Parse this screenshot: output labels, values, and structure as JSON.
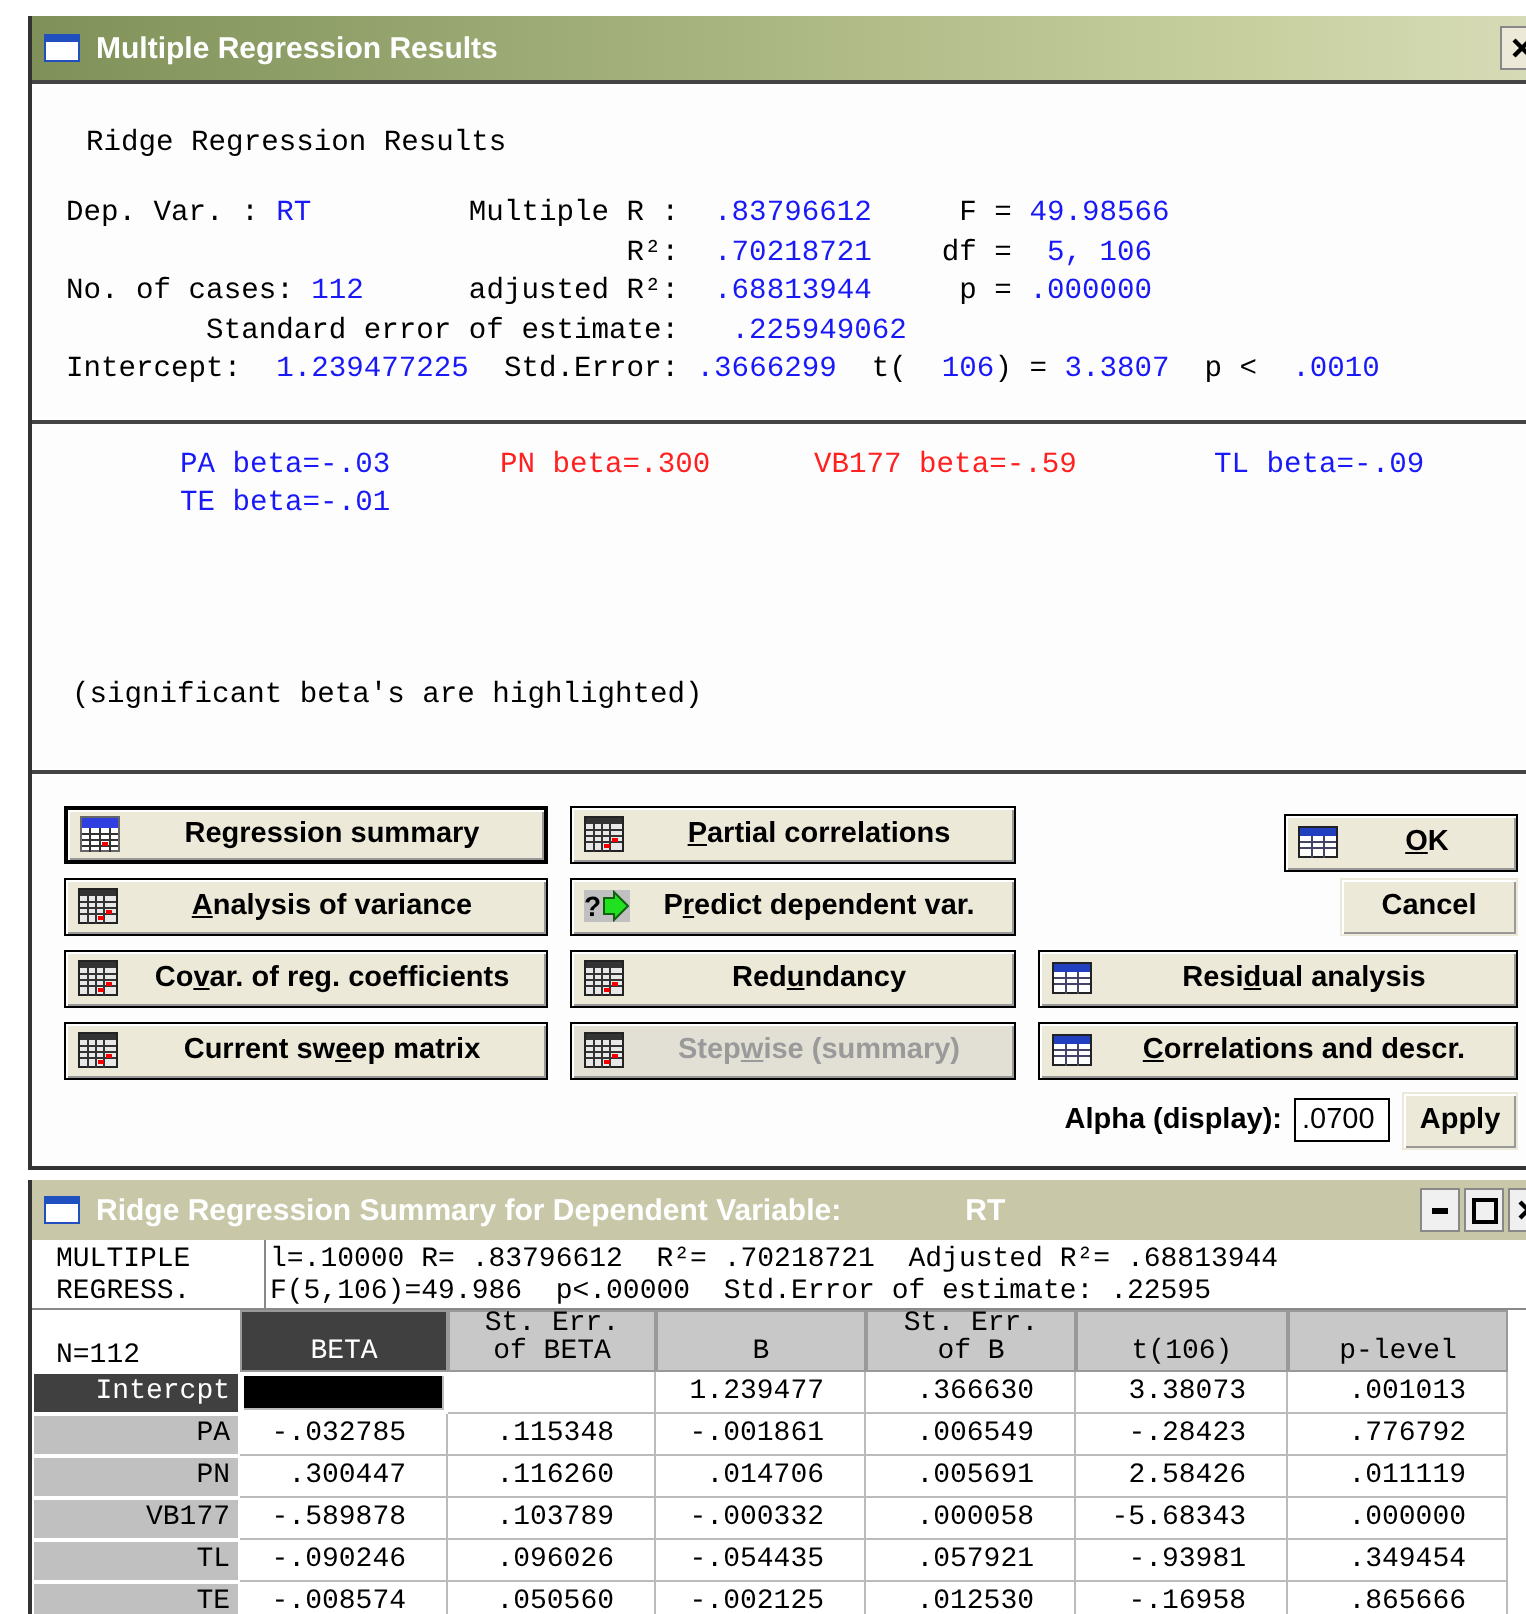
{
  "window": {
    "title": "Multiple Regression Results"
  },
  "results": {
    "heading": "Ridge Regression Results",
    "lines": [
      [
        {
          "kind": "label",
          "text": "Dep. Var. : "
        },
        {
          "kind": "value",
          "text": "RT"
        },
        {
          "kind": "label",
          "text": "         Multiple R :  "
        },
        {
          "kind": "value",
          "text": ".83796612"
        },
        {
          "kind": "label",
          "text": "     F = "
        },
        {
          "kind": "value",
          "text": "49.98566"
        }
      ],
      [
        {
          "kind": "label",
          "text": "                                R²:  "
        },
        {
          "kind": "value",
          "text": ".70218721"
        },
        {
          "kind": "label",
          "text": "    df =  "
        },
        {
          "kind": "value",
          "text": "5, 106"
        }
      ],
      [
        {
          "kind": "label",
          "text": "No. of cases: "
        },
        {
          "kind": "value",
          "text": "112"
        },
        {
          "kind": "label",
          "text": "      adjusted R²:  "
        },
        {
          "kind": "value",
          "text": ".68813944"
        },
        {
          "kind": "label",
          "text": "     p = "
        },
        {
          "kind": "value",
          "text": ".000000"
        }
      ],
      [
        {
          "kind": "label",
          "text": "        Standard error of estimate:   "
        },
        {
          "kind": "value",
          "text": ".225949062"
        }
      ],
      [
        {
          "kind": "label",
          "text": "Intercept:  "
        },
        {
          "kind": "value",
          "text": "1.239477225"
        },
        {
          "kind": "label",
          "text": "  Std.Error: "
        },
        {
          "kind": "value",
          "text": ".3666299"
        },
        {
          "kind": "label",
          "text": "  t(  "
        },
        {
          "kind": "value",
          "text": "106"
        },
        {
          "kind": "label",
          "text": ") = "
        },
        {
          "kind": "value",
          "text": "3.3807"
        },
        {
          "kind": "label",
          "text": "  p <  "
        },
        {
          "kind": "value",
          "text": ".0010"
        }
      ]
    ]
  },
  "betas": [
    {
      "text": "PA beta=-.03",
      "significant": false
    },
    {
      "text": "PN beta=.300",
      "significant": true
    },
    {
      "text": "VB177 beta=-.59",
      "significant": true
    },
    {
      "text": "TL beta=-.09",
      "significant": false
    },
    {
      "text": "TE beta=-.01",
      "significant": false
    }
  ],
  "note": "(significant beta's are highlighted)",
  "buttons": [
    [
      {
        "kind": "summary",
        "pre": "Regression summary",
        "default": true,
        "disabled": false
      },
      {
        "kind": "grid",
        "key": "P",
        "post": "artial correlations",
        "default": false,
        "disabled": false
      }
    ],
    [
      {
        "kind": "grid",
        "key": "A",
        "post": "nalysis of variance",
        "default": false,
        "disabled": false
      },
      {
        "kind": "predict",
        "icon_text": "?",
        "pre": "P",
        "key": "r",
        "post": "edict dependent var.",
        "default": false,
        "disabled": false
      }
    ],
    [
      {
        "kind": "grid",
        "pre": "Co",
        "key": "v",
        "post": "ar. of reg. coefficients",
        "default": false,
        "disabled": false
      },
      {
        "kind": "grid",
        "pre": "Red",
        "key": "u",
        "post": "ndancy",
        "default": false,
        "disabled": false
      },
      {
        "kind": "table",
        "pre": "Resi",
        "key": "d",
        "post": "ual analysis",
        "default": false,
        "disabled": false
      }
    ],
    [
      {
        "kind": "grid",
        "pre": "Current sw",
        "key": "e",
        "post": "ep matrix",
        "default": false,
        "disabled": false
      },
      {
        "kind": "grid",
        "pre": "Step",
        "key": "w",
        "post": "ise (summary)",
        "default": false,
        "disabled": true
      },
      {
        "kind": "table",
        "key": "C",
        "post": "orrelations and descr.",
        "default": false,
        "disabled": false
      }
    ]
  ],
  "ok": {
    "key": "O",
    "post": "K"
  },
  "cancel": "Cancel",
  "alpha": {
    "label": "Alpha (display):",
    "value": ".0700",
    "apply": "Apply"
  },
  "summary": {
    "title": "Ridge Regression Summary for Dependent Variable:",
    "title_var": "RT",
    "side": [
      "MULTIPLE",
      "REGRESS."
    ],
    "info": [
      "l=.10000 R= .83796612  R²= .70218721  Adjusted R²= .68813944",
      "F(5,106)=49.986  p<.00000  Std.Error of estimate: .22595"
    ],
    "corner": "N=112",
    "columns": [
      {
        "label": [
          "BETA"
        ],
        "selected": true
      },
      {
        "label": [
          "St. Err.",
          "of BETA"
        ],
        "selected": false
      },
      {
        "label": [
          "B"
        ],
        "selected": false
      },
      {
        "label": [
          "St. Err.",
          "of B"
        ],
        "selected": false
      },
      {
        "label": [
          "t(106)"
        ],
        "selected": false
      },
      {
        "label": [
          "p-level"
        ],
        "selected": false
      }
    ],
    "rows": [
      {
        "label": "Intercpt",
        "selected": true,
        "cells": [
          {
            "selected": true
          },
          {
            "selected": false
          },
          {
            "text": "1.239477",
            "selected": false
          },
          {
            "text": ".366630",
            "selected": false
          },
          {
            "text": "3.38073",
            "selected": false
          },
          {
            "text": ".001013",
            "selected": false
          }
        ]
      },
      {
        "label": "PA",
        "selected": false,
        "cells": [
          {
            "text": "-.032785",
            "selected": false
          },
          {
            "text": ".115348",
            "selected": false
          },
          {
            "text": "-.001861",
            "selected": false
          },
          {
            "text": ".006549",
            "selected": false
          },
          {
            "text": "-.28423",
            "selected": false
          },
          {
            "text": ".776792",
            "selected": false
          }
        ]
      },
      {
        "label": "PN",
        "selected": false,
        "cells": [
          {
            "text": ".300447",
            "selected": false
          },
          {
            "text": ".116260",
            "selected": false
          },
          {
            "text": ".014706",
            "selected": false
          },
          {
            "text": ".005691",
            "selected": false
          },
          {
            "text": "2.58426",
            "selected": false
          },
          {
            "text": ".011119",
            "selected": false
          }
        ]
      },
      {
        "label": "VB177",
        "selected": false,
        "cells": [
          {
            "text": "-.589878",
            "selected": false
          },
          {
            "text": ".103789",
            "selected": false
          },
          {
            "text": "-.000332",
            "selected": false
          },
          {
            "text": ".000058",
            "selected": false
          },
          {
            "text": "-5.68343",
            "selected": false
          },
          {
            "text": ".000000",
            "selected": false
          }
        ]
      },
      {
        "label": "TL",
        "selected": false,
        "cells": [
          {
            "text": "-.090246",
            "selected": false
          },
          {
            "text": ".096026",
            "selected": false
          },
          {
            "text": "-.054435",
            "selected": false
          },
          {
            "text": ".057921",
            "selected": false
          },
          {
            "text": "-.93981",
            "selected": false
          },
          {
            "text": ".349454",
            "selected": false
          }
        ]
      },
      {
        "label": "TE",
        "selected": false,
        "cells": [
          {
            "text": "-.008574",
            "selected": false
          },
          {
            "text": ".050560",
            "selected": false
          },
          {
            "text": "-.002125",
            "selected": false
          },
          {
            "text": ".012530",
            "selected": false
          },
          {
            "text": "-.16958",
            "selected": false
          },
          {
            "text": ".865666",
            "selected": false
          }
        ]
      }
    ]
  }
}
